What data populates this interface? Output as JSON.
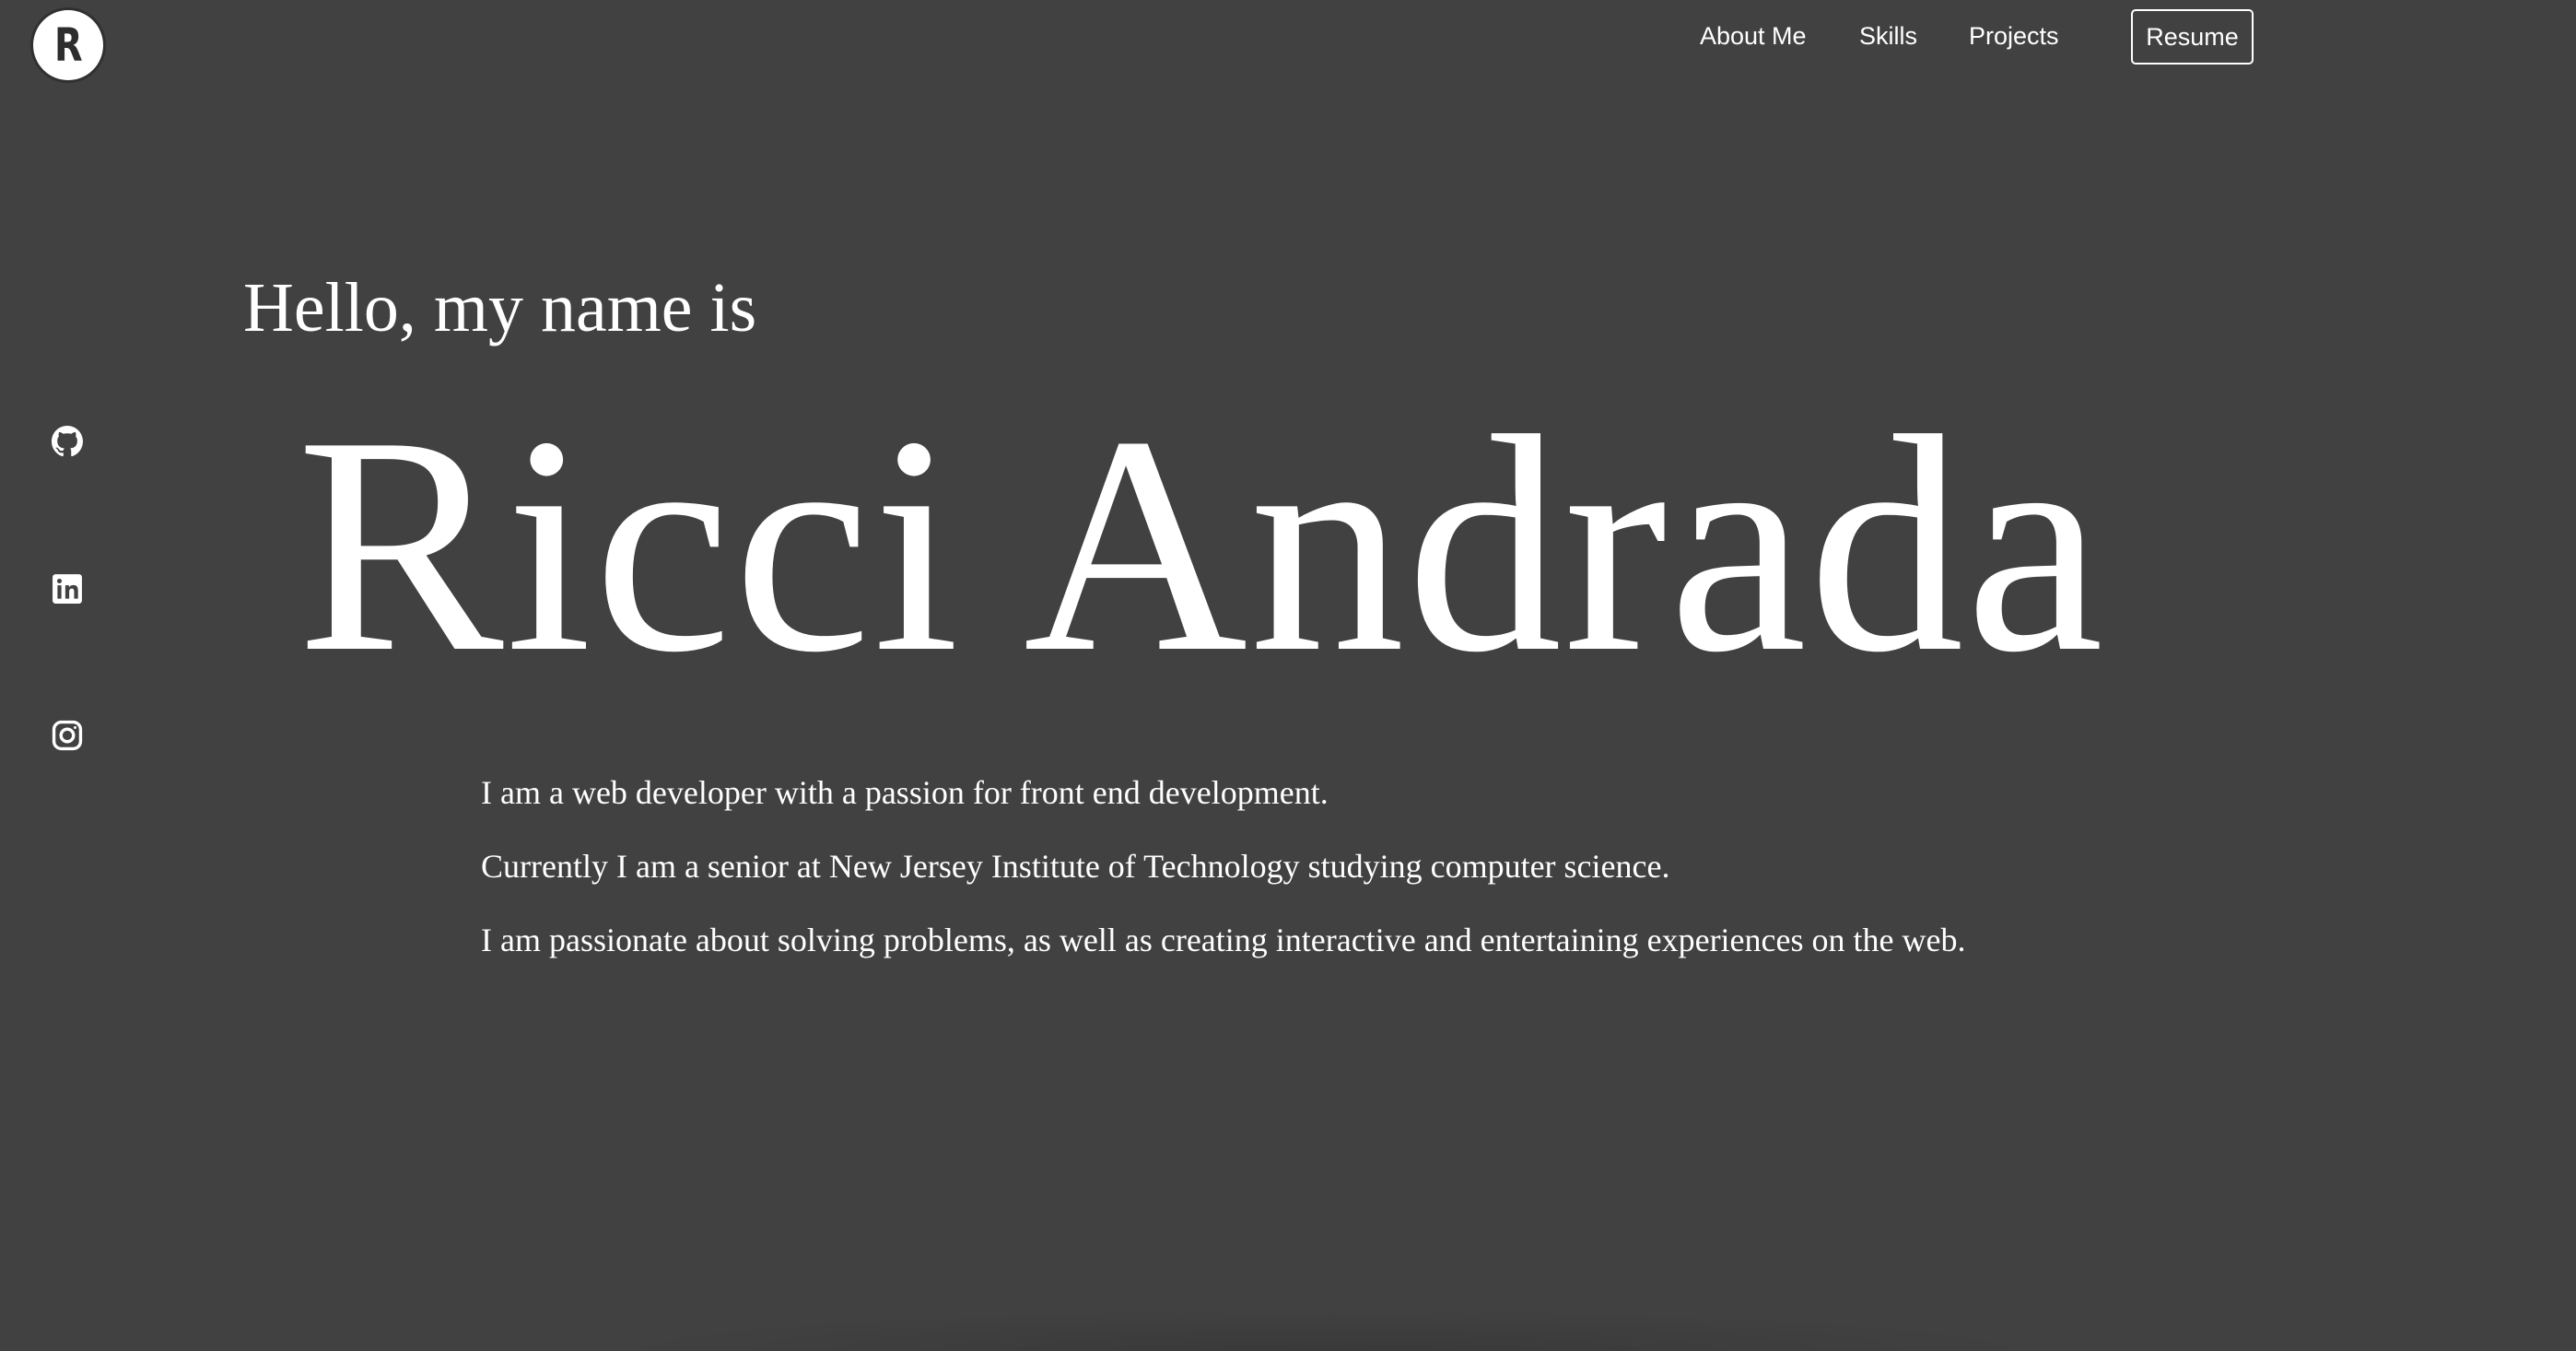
{
  "logo": {
    "letter": "R"
  },
  "nav": {
    "items": [
      {
        "label": "About Me"
      },
      {
        "label": "Skills"
      },
      {
        "label": "Projects"
      }
    ],
    "resume_label": "Resume"
  },
  "social": {
    "icons": [
      "github-icon",
      "linkedin-icon",
      "instagram-icon"
    ]
  },
  "hero": {
    "greeting": "Hello, my name is",
    "name": "Ricci Andrada",
    "bio": [
      "I am a web developer with a passion for front end development.",
      "Currently I am a senior at New Jersey Institute of Technology studying computer science.",
      "I am passionate about solving problems, as well as creating interactive and entertaining experiences on the web."
    ]
  },
  "colors": {
    "background": "#414141",
    "text": "#ffffff"
  }
}
